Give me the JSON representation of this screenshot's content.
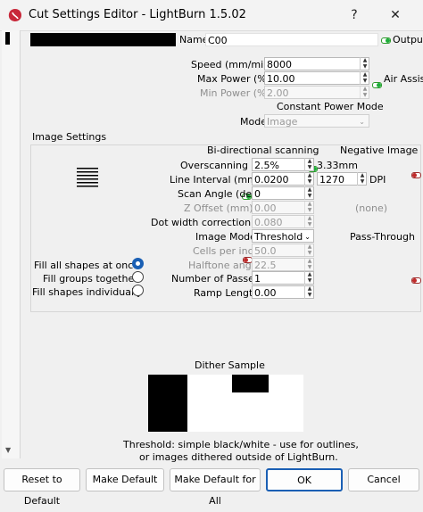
{
  "window": {
    "title": "Cut Settings Editor - LightBurn 1.5.02",
    "help_glyph": "?",
    "close_glyph": "✕"
  },
  "main": {
    "name_label": "Name",
    "name_value": "C00",
    "output_label": "Output",
    "speed_label": "Speed (mm/min)",
    "speed_value": "8000",
    "max_power_label": "Max Power (%)",
    "max_power_value": "10.00",
    "air_assist_label": "Air Assist",
    "min_power_label": "Min Power (%)",
    "min_power_value": "2.00",
    "constant_power_label": "Constant Power Mode",
    "mode_label": "Mode",
    "mode_value": "Image"
  },
  "image_settings": {
    "heading": "Image Settings",
    "bidirectional_label": "Bi-directional scanning",
    "negative_label": "Negative Image",
    "overscanning_label": "Overscanning",
    "overscanning_value": "2.5%",
    "overscanning_mm": "3.33mm",
    "line_interval_label": "Line Interval (mm)",
    "line_interval_value": "0.0200",
    "dpi_value": "1270",
    "dpi_label": "DPI",
    "scan_angle_label": "Scan Angle (deg)",
    "scan_angle_value": "0",
    "z_offset_label": "Z Offset (mm)",
    "z_offset_value": "0.00",
    "z_offset_none": "(none)",
    "dot_width_label": "Dot width correction",
    "dot_width_value": "0.080",
    "image_mode_label": "Image Mode",
    "image_mode_value": "Threshold",
    "pass_through_label": "Pass-Through",
    "cells_label": "Cells per inch",
    "cells_value": "50.0",
    "halftone_label": "Halftone angle",
    "halftone_value": "22.5",
    "passes_label": "Number of Passes",
    "passes_value": "1",
    "ramp_label": "Ramp Length",
    "ramp_value": "0.00",
    "fill_all_label": "Fill all shapes at once",
    "fill_groups_label": "Fill groups together",
    "fill_individually_label": "Fill shapes individually"
  },
  "dither": {
    "heading": "Dither Sample",
    "caption_line1": "Threshold: simple black/white - use for outlines,",
    "caption_line2": "or images dithered outside of LightBurn."
  },
  "footer": {
    "reset_label": "Reset to Default",
    "make_default_label": "Make Default",
    "make_default_all_label": "Make Default for All",
    "ok_label": "OK",
    "cancel_label": "Cancel"
  },
  "colors": {
    "accent": "#1a5fb4",
    "toggle_on": "#1fae3a",
    "toggle_off": "#c02b2b"
  }
}
